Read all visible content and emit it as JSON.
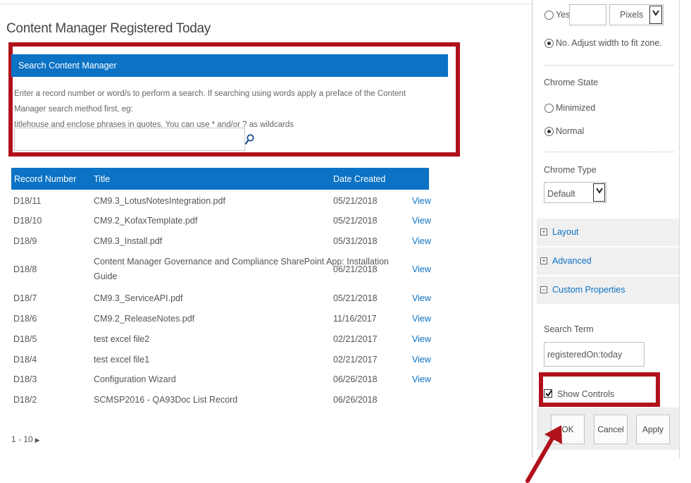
{
  "page": {
    "title": "Content Manager Registered Today"
  },
  "search": {
    "header": "Search Content Manager",
    "help_line1": "Enter a record number or word/s to perform a search. If searching using words apply a preface of the Content Manager search method first, eg:",
    "help_line2": "titlehouse and enclose phrases in quotes. You can use * and/or ? as wildcards",
    "input_value": ""
  },
  "table": {
    "headers": {
      "record_number": "Record Number",
      "title": "Title",
      "date_created": "Date Created"
    },
    "view_label": "View",
    "rows": [
      {
        "record": "D18/11",
        "title": "CM9.3_LotusNotesIntegration.pdf",
        "date": "05/21/2018"
      },
      {
        "record": "D18/10",
        "title": "CM9.2_KofaxTemplate.pdf",
        "date": "05/21/2018"
      },
      {
        "record": "D18/9",
        "title": "CM9.3_Install.pdf",
        "date": "05/31/2018"
      },
      {
        "record": "D18/8",
        "title_line1": "Content Manager Governance and Compliance SharePoint App: Installation",
        "title_line2": "Guide",
        "date": "06/21/2018"
      },
      {
        "record": "D18/7",
        "title": "CM9.3_ServiceAPI.pdf",
        "date": "05/21/2018"
      },
      {
        "record": "D18/6",
        "title": "CM9.2_ReleaseNotes.pdf",
        "date": "11/16/2017"
      },
      {
        "record": "D18/5",
        "title": "test excel file2",
        "date": "02/21/2017"
      },
      {
        "record": "D18/4",
        "title": "test excel file1",
        "date": "02/21/2017"
      },
      {
        "record": "D18/3",
        "title": "Configuration Wizard",
        "date": "06/26/2018"
      },
      {
        "record": "D18/2",
        "title": "SCMSP2016 - QA93Doc List Record",
        "date": "06/26/2018"
      }
    ]
  },
  "pager": {
    "range": "1 - 10",
    "next_icon": "triangle-right"
  },
  "tool_pane": {
    "width": {
      "yes_label": "Yes",
      "units_value": "Pixels",
      "no_label": "No. Adjust width to fit zone.",
      "selected": "no"
    },
    "chrome_state": {
      "label": "Chrome State",
      "minimized": "Minimized",
      "normal": "Normal",
      "selected": "normal"
    },
    "chrome_type": {
      "label": "Chrome Type",
      "value": "Default"
    },
    "sections": [
      {
        "label": "Layout",
        "state": "+"
      },
      {
        "label": "Advanced",
        "state": "+"
      },
      {
        "label": "Custom Properties",
        "state": "−"
      }
    ],
    "search_term": {
      "label": "Search Term",
      "value": "registeredOn:today"
    },
    "show_controls": {
      "label": "Show Controls",
      "checked": true
    },
    "buttons": {
      "ok": "OK",
      "cancel": "Cancel",
      "apply": "Apply"
    }
  },
  "colors": {
    "header_blue": "#0b72c4",
    "highlight_red": "#b0111b"
  }
}
